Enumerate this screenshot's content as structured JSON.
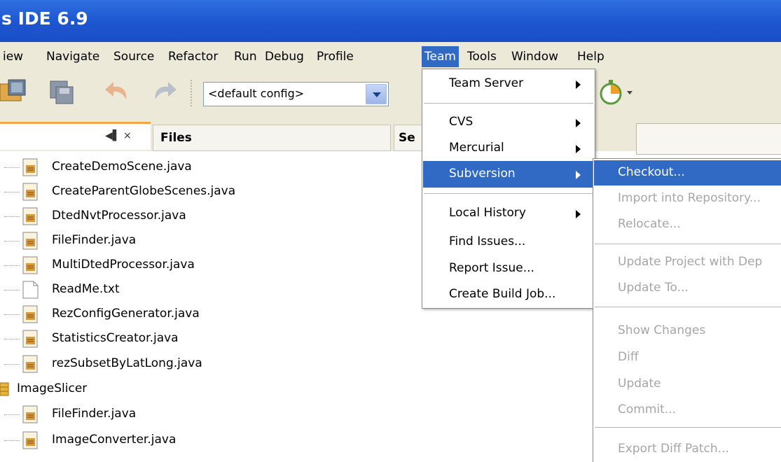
{
  "window": {
    "title": "s IDE 6.9"
  },
  "menubar": {
    "items": [
      "iew",
      "Navigate",
      "Source",
      "Refactor",
      "Run",
      "Debug",
      "Profile",
      "Team",
      "Tools",
      "Window",
      "Help"
    ]
  },
  "toolbar": {
    "config_value": "<default config>"
  },
  "tabs": {
    "close_controls": "◀▌ ×",
    "files": "Files",
    "services_partial": "Se"
  },
  "files": [
    "CreateDemoScene.java",
    "CreateParentGlobeScenes.java",
    "DtedNvtProcessor.java",
    "FileFinder.java",
    "MultiDtedProcessor.java",
    "ReadMe.txt",
    "RezConfigGenerator.java",
    "StatisticsCreator.java",
    "rezSubsetByLatLong.java",
    "ImageSlicer",
    "FileFinder.java",
    "ImageConverter.java"
  ],
  "team_menu": {
    "items": [
      "Team Server",
      "CVS",
      "Mercurial",
      "Subversion",
      "Local History",
      "Find Issues...",
      "Report Issue...",
      "Create Build Job..."
    ]
  },
  "subversion_menu": {
    "items": [
      "Checkout...",
      "Import into Repository...",
      "Relocate...",
      "Update Project with Dep",
      "Update To...",
      "Show Changes",
      "Diff",
      "Update",
      "Commit...",
      "Export Diff Patch..."
    ]
  }
}
